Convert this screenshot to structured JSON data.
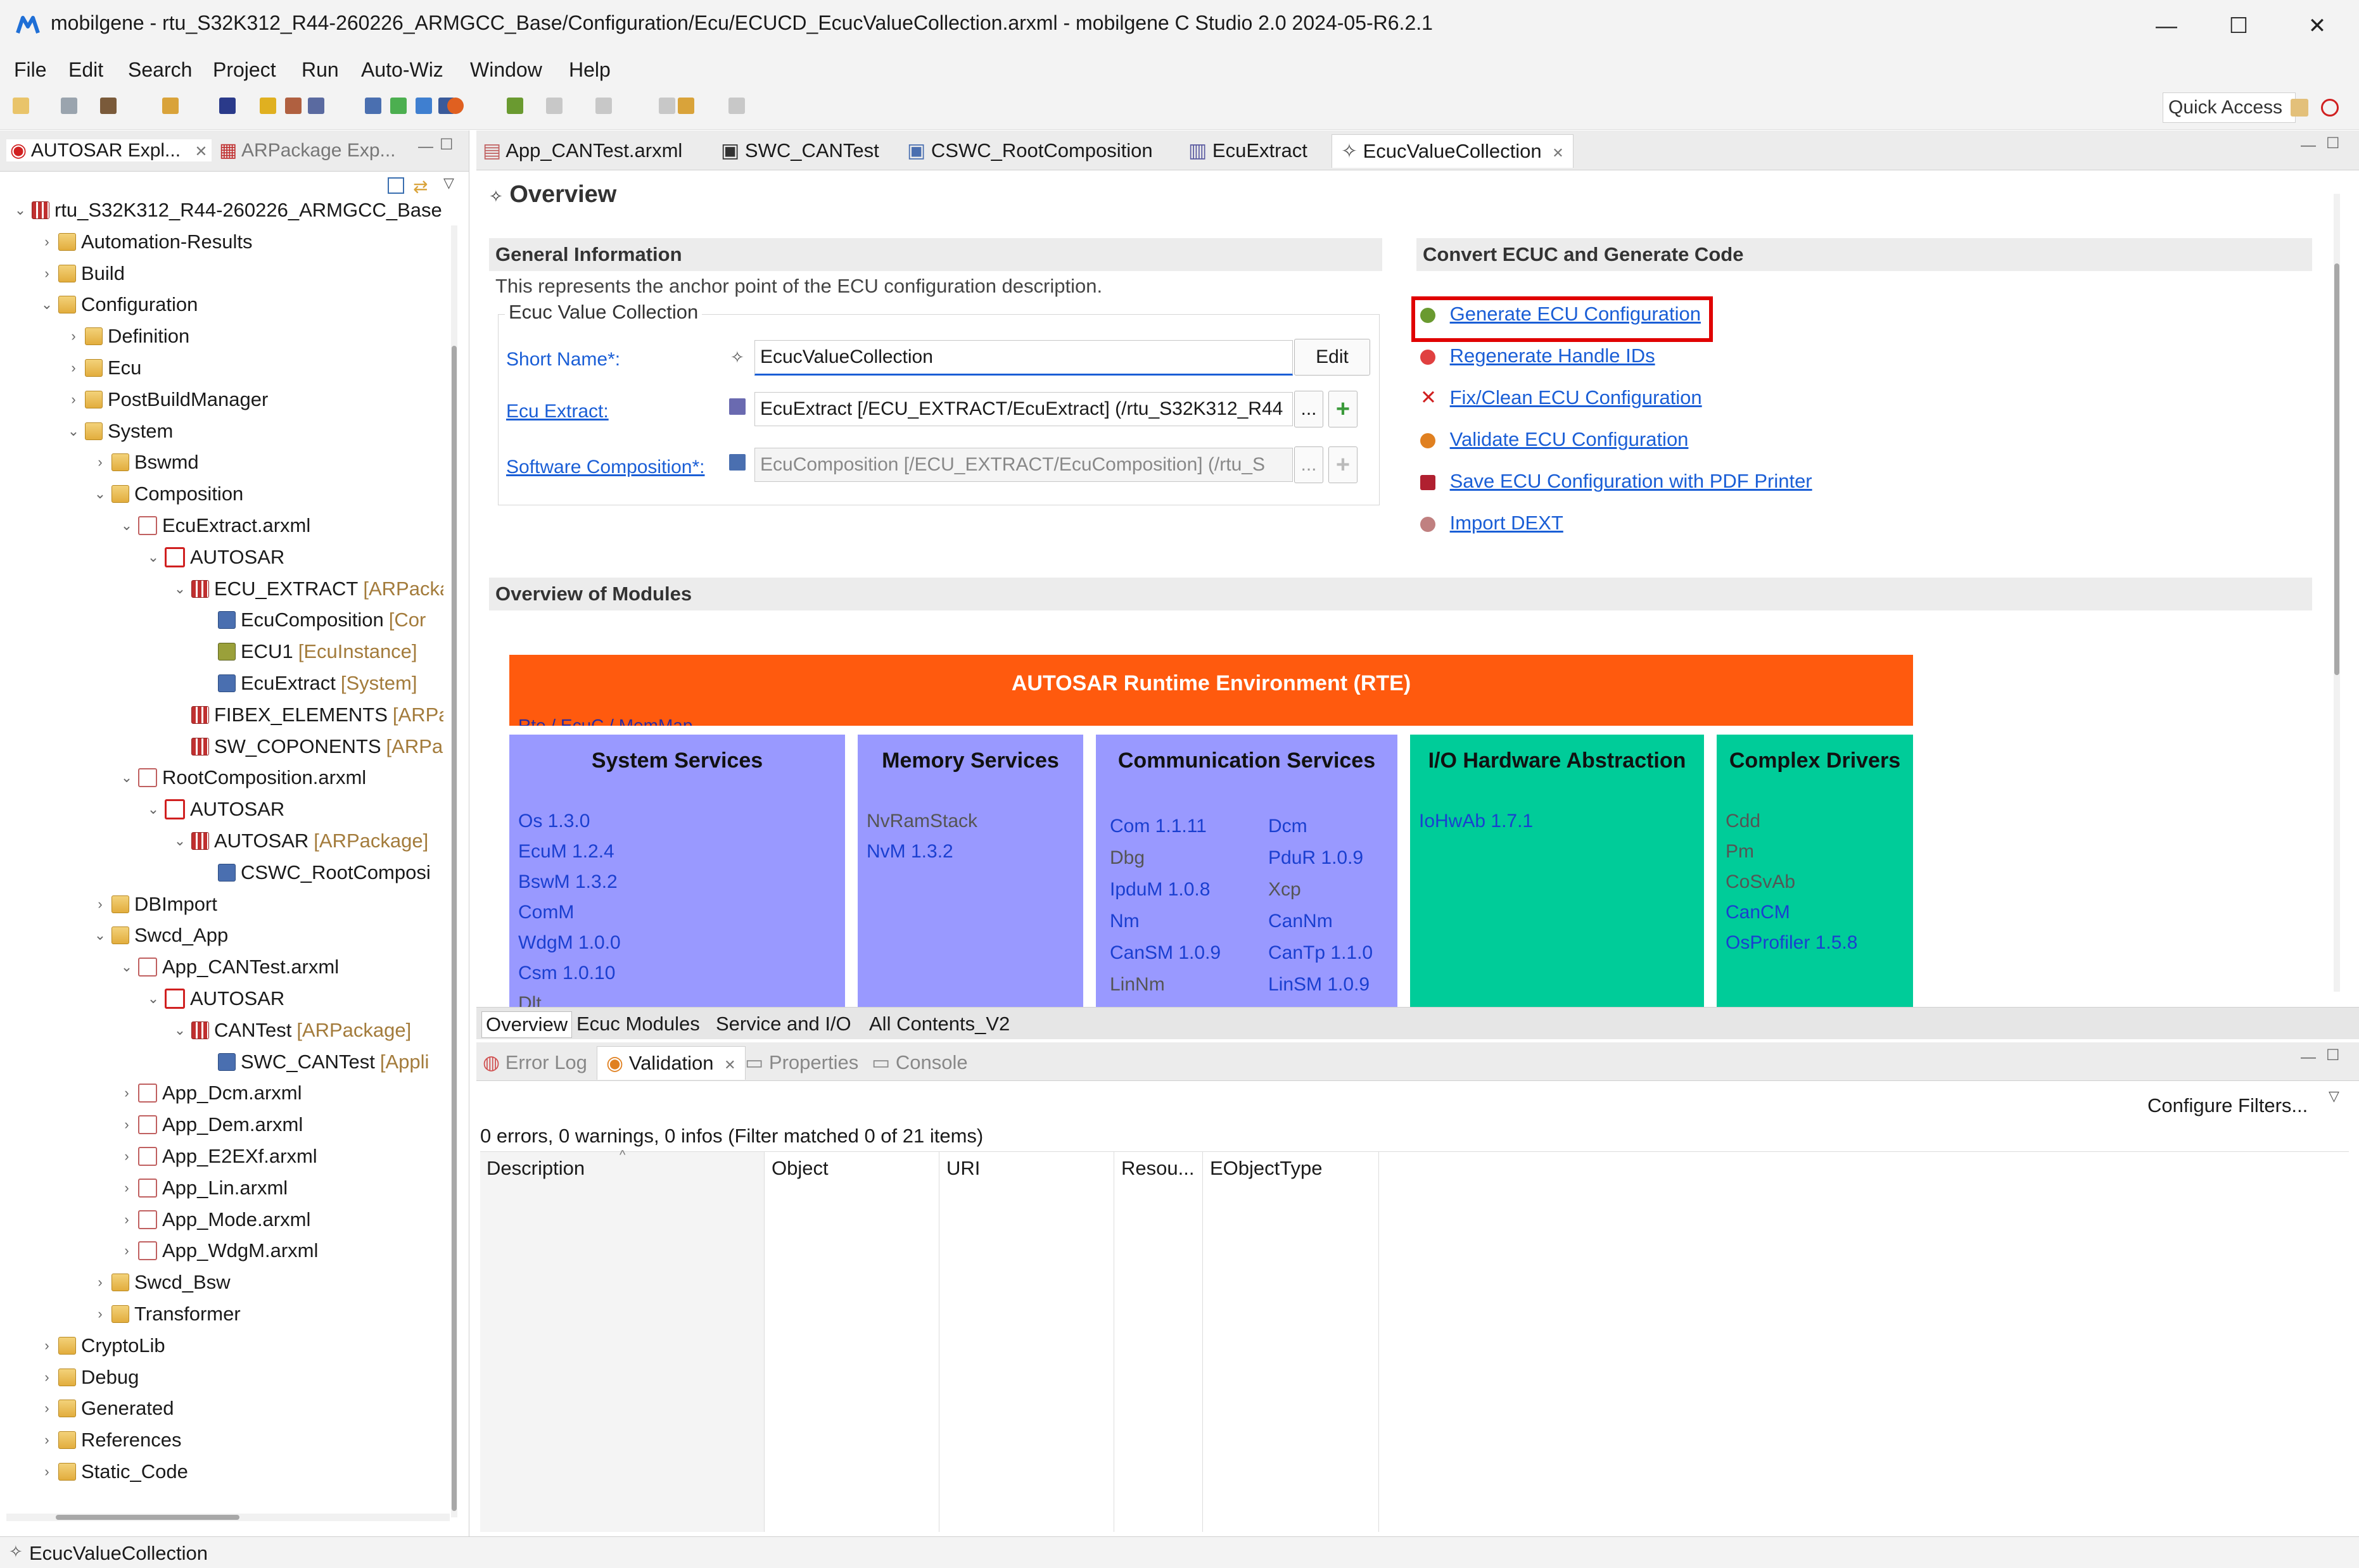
{
  "window": {
    "title": "mobilgene - rtu_S32K312_R44-260226_ARMGCC_Base/Configuration/Ecu/ECUCD_EcucValueCollection.arxml - mobilgene C Studio 2.0 2024-05-R6.2.1",
    "minimize": "—",
    "maximize": "☐",
    "close": "✕"
  },
  "menu": [
    "File",
    "Edit",
    "Search",
    "Project",
    "Run",
    "Auto-Wiz",
    "Window",
    "Help"
  ],
  "quick_access": "Quick Access",
  "left_panel": {
    "tabs": [
      "AUTOSAR Expl...",
      "ARPackage Exp..."
    ],
    "tree": [
      {
        "label": "rtu_S32K312_R44-260226_ARMGCC_Base",
        "icon": "project-icon",
        "twisty": "open"
      },
      {
        "label": "Automation-Results",
        "icon": "folder-icon",
        "twisty": "closed"
      },
      {
        "label": "Build",
        "icon": "folder-icon",
        "twisty": "closed"
      },
      {
        "label": "Configuration",
        "icon": "folder-icon",
        "twisty": "open"
      },
      {
        "label": "Definition",
        "icon": "folder-icon",
        "twisty": "closed"
      },
      {
        "label": "Ecu",
        "icon": "folder-icon",
        "twisty": "closed"
      },
      {
        "label": "PostBuildManager",
        "icon": "folder-icon",
        "twisty": "closed"
      },
      {
        "label": "System",
        "icon": "folder-icon",
        "twisty": "open"
      },
      {
        "label": "Bswmd",
        "icon": "folder-icon",
        "twisty": "closed"
      },
      {
        "label": "Composition",
        "icon": "folder-icon",
        "twisty": "open"
      },
      {
        "label": "EcuExtract.arxml",
        "icon": "arxml-file-icon",
        "twisty": "open"
      },
      {
        "label": "AUTOSAR",
        "icon": "autosar-icon",
        "twisty": "open"
      },
      {
        "label": "ECU_EXTRACT",
        "suffix": "[ARPacka",
        "icon": "package-icon",
        "twisty": "open"
      },
      {
        "label": "EcuComposition",
        "suffix": "[Cor",
        "icon": "composition-icon",
        "twisty": ""
      },
      {
        "label": "ECU1",
        "suffix": "[EcuInstance]",
        "icon": "ecu-instance-icon",
        "twisty": ""
      },
      {
        "label": "EcuExtract",
        "suffix": "[System]",
        "icon": "composition-icon",
        "twisty": ""
      },
      {
        "label": "FIBEX_ELEMENTS",
        "suffix": "[ARPa",
        "icon": "package-icon",
        "twisty": ""
      },
      {
        "label": "SW_COPONENTS",
        "suffix": "[ARPa",
        "icon": "package-icon",
        "twisty": ""
      },
      {
        "label": "RootComposition.arxml",
        "icon": "arxml-file-icon",
        "twisty": "open"
      },
      {
        "label": "AUTOSAR",
        "icon": "autosar-icon",
        "twisty": "open"
      },
      {
        "label": "AUTOSAR",
        "suffix": "[ARPackage]",
        "icon": "package-icon",
        "twisty": "open"
      },
      {
        "label": "CSWC_RootComposi",
        "icon": "composition-icon",
        "twisty": ""
      },
      {
        "label": "DBImport",
        "icon": "folder-icon",
        "twisty": "closed"
      },
      {
        "label": "Swcd_App",
        "icon": "folder-icon",
        "twisty": "open"
      },
      {
        "label": "App_CANTest.arxml",
        "icon": "arxml-file-icon",
        "twisty": "open"
      },
      {
        "label": "AUTOSAR",
        "icon": "autosar-icon",
        "twisty": "open"
      },
      {
        "label": "CANTest",
        "suffix": "[ARPackage]",
        "icon": "package-icon",
        "twisty": "open"
      },
      {
        "label": "SWC_CANTest",
        "suffix": "[Appli",
        "icon": "swc-icon",
        "twisty": ""
      },
      {
        "label": "App_Dcm.arxml",
        "icon": "arxml-file-icon",
        "twisty": "closed"
      },
      {
        "label": "App_Dem.arxml",
        "icon": "arxml-file-icon",
        "twisty": "closed"
      },
      {
        "label": "App_E2EXf.arxml",
        "icon": "arxml-file-icon",
        "twisty": "closed"
      },
      {
        "label": "App_Lin.arxml",
        "icon": "arxml-file-icon",
        "twisty": "closed"
      },
      {
        "label": "App_Mode.arxml",
        "icon": "arxml-file-icon",
        "twisty": "closed"
      },
      {
        "label": "App_WdgM.arxml",
        "icon": "arxml-file-icon",
        "twisty": "closed"
      },
      {
        "label": "Swcd_Bsw",
        "icon": "folder-icon",
        "twisty": "closed"
      },
      {
        "label": "Transformer",
        "icon": "folder-icon",
        "twisty": "closed"
      },
      {
        "label": "CryptoLib",
        "icon": "folder-icon",
        "twisty": "closed"
      },
      {
        "label": "Debug",
        "icon": "folder-icon",
        "twisty": "closed"
      },
      {
        "label": "Generated",
        "icon": "folder-icon",
        "twisty": "closed"
      },
      {
        "label": "References",
        "icon": "folder-icon",
        "twisty": "closed"
      },
      {
        "label": "Static_Code",
        "icon": "folder-icon",
        "twisty": "closed"
      }
    ]
  },
  "editor": {
    "tabs": [
      "App_CANTest.arxml",
      "SWC_CANTest",
      "CSWC_RootComposition",
      "EcuExtract",
      "EcucValueCollection"
    ],
    "active_tab": "EcucValueCollection",
    "heading": "Overview",
    "general": {
      "title": "General Information",
      "description": "This represents the anchor point of the ECU configuration description.",
      "group_title": "Ecuc Value Collection",
      "short_name_label": "Short Name*:",
      "short_name_value": "EcucValueCollection",
      "edit_button": "Edit",
      "ecu_extract_label": "Ecu Extract:",
      "ecu_extract_value": "EcuExtract [/ECU_EXTRACT/EcuExtract] (/rtu_S32K312_R44",
      "software_composition_label": "Software Composition*:",
      "software_composition_value": "EcuComposition [/ECU_EXTRACT/EcuComposition] (/rtu_S",
      "browse": "...",
      "add": "+"
    },
    "convert": {
      "title": "Convert ECUC and Generate Code",
      "links": [
        "Generate ECU Configuration",
        "Regenerate Handle IDs",
        "Fix/Clean ECU Configuration",
        "Validate ECU Configuration",
        "Save ECU Configuration with PDF Printer",
        "Import DEXT"
      ]
    },
    "modules": {
      "title": "Overview of Modules",
      "rte_title": "AUTOSAR Runtime Environment (RTE)",
      "rte_sub": "Rte / EcuC / MemMap",
      "system_services": {
        "title": "System Services",
        "items": [
          "Os 1.3.0",
          "EcuM 1.2.4",
          "BswM 1.3.2",
          "ComM",
          "WdgM 1.0.0",
          "Csm 1.0.10",
          "Dlt"
        ]
      },
      "memory_services": {
        "title": "Memory Services",
        "items": [
          "NvRamStack",
          "NvM 1.3.2"
        ]
      },
      "communication_services": {
        "title": "Communication Services",
        "left": [
          "Com 1.1.11",
          "Dbg",
          "IpduM 1.0.8",
          "Nm",
          "CanSM 1.0.9",
          "LinNm"
        ],
        "right": [
          "Dcm",
          "PduR 1.0.9",
          "Xcp",
          "CanNm",
          "CanTp 1.1.0",
          "LinSM 1.0.9"
        ]
      },
      "io_hw": {
        "title": "I/O Hardware Abstraction",
        "items": [
          "IoHwAb 1.7.1"
        ]
      },
      "complex_drivers": {
        "title": "Complex Drivers",
        "items": [
          "Cdd",
          "Pm",
          "CoSvAb",
          "CanCM",
          "OsProfiler 1.5.8"
        ]
      }
    },
    "bottom_tabs": [
      "Overview",
      "Ecuc Modules",
      "Service and I/O",
      "All Contents_V2"
    ]
  },
  "lower": {
    "tabs": [
      "Error Log",
      "Validation",
      "Properties",
      "Console"
    ],
    "active_tab": "Validation",
    "configure_filters": "Configure Filters...",
    "summary": "0 errors, 0 warnings, 0 infos (Filter matched 0 of 21 items)",
    "columns": [
      "Description",
      "Object",
      "URI",
      "Resou...",
      "EObjectType"
    ]
  },
  "status": "EcucValueCollection",
  "colors": {
    "rte": "#ff5a0e",
    "system_services": "#9999ff",
    "communication_services": "#9999ff",
    "io_hw": "#00cc99",
    "complex_drivers": "#00cc99",
    "link": "#1a5ed6",
    "highlight": "#e00000"
  }
}
